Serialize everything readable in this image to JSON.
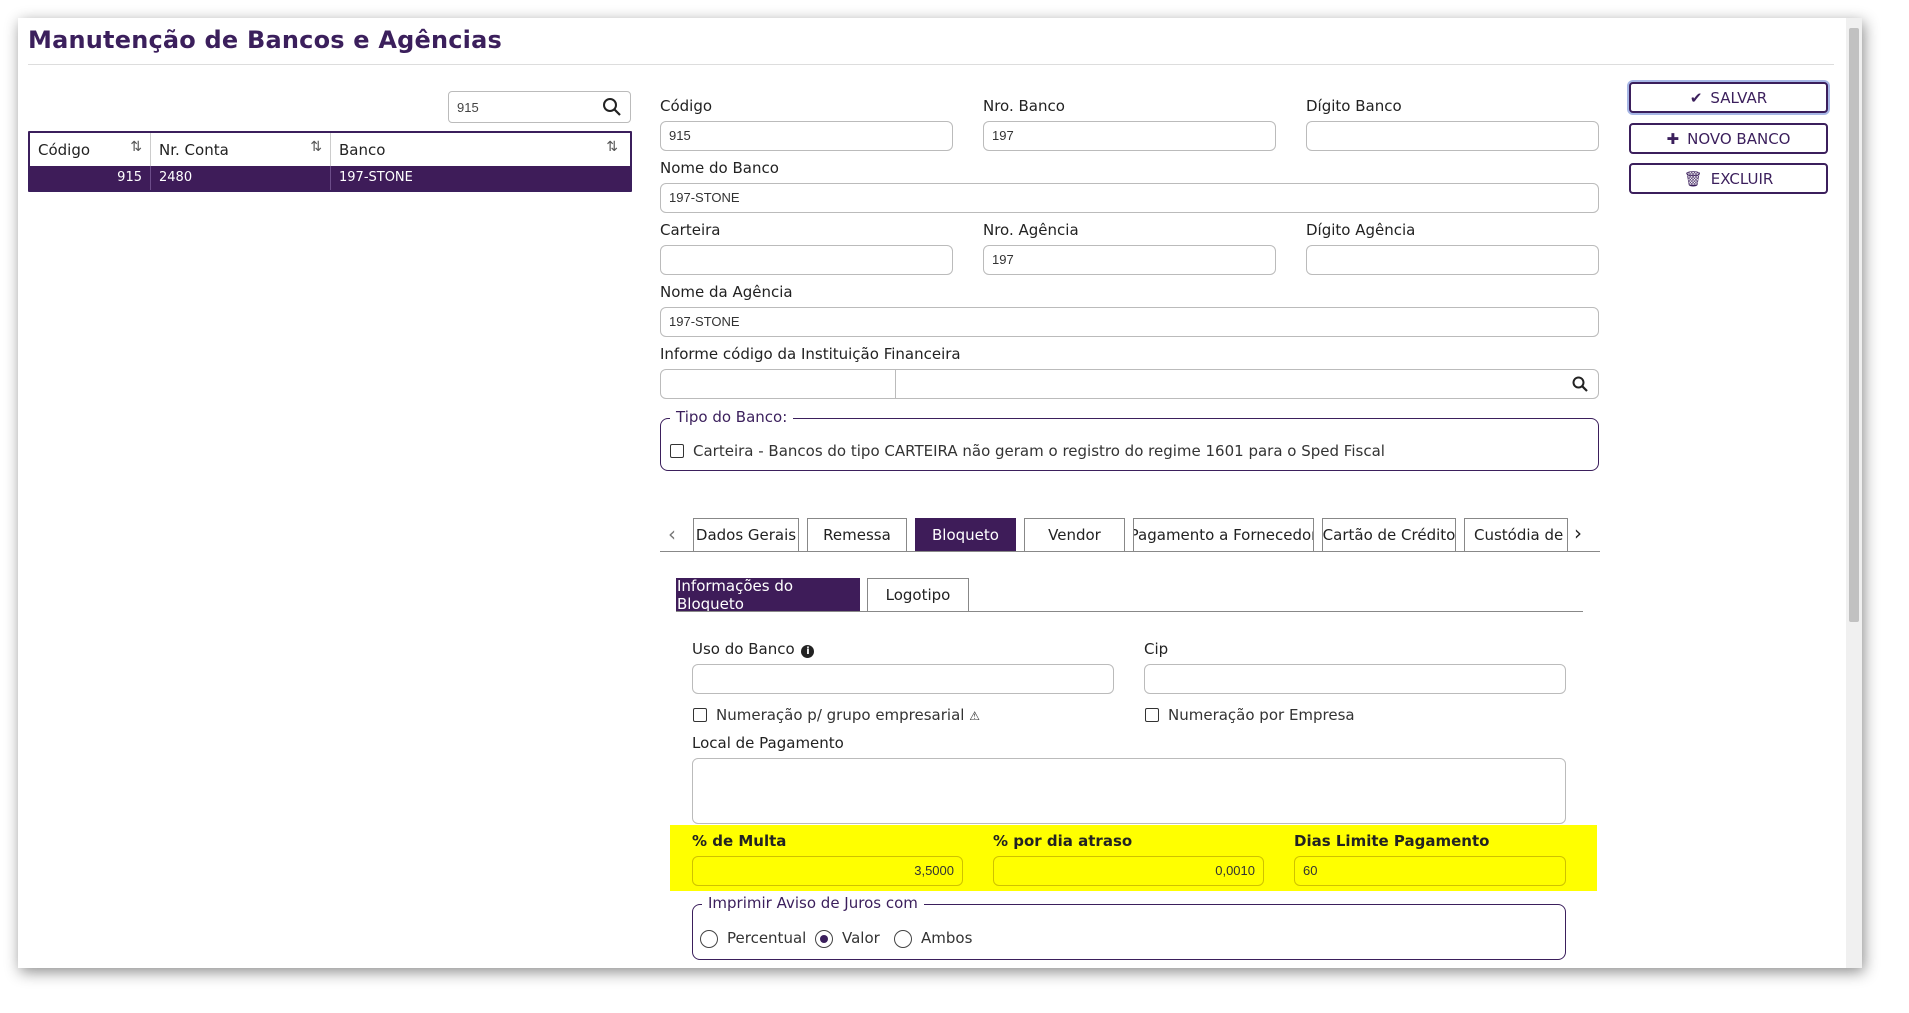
{
  "page": {
    "title": "Manutenção de Bancos e Agências"
  },
  "search": {
    "value": "915"
  },
  "grid": {
    "columns": [
      "Código",
      "Nr. Conta",
      "Banco"
    ],
    "rows": [
      {
        "codigo": "915",
        "nr_conta": "2480",
        "banco": "197-STONE"
      }
    ]
  },
  "form": {
    "codigo": {
      "label": "Código",
      "value": "915"
    },
    "nro_banco": {
      "label": "Nro. Banco",
      "value": "197"
    },
    "digito_banco": {
      "label": "Dígito Banco",
      "value": ""
    },
    "nome_banco": {
      "label": "Nome do Banco",
      "value": "197-STONE"
    },
    "carteira": {
      "label": "Carteira",
      "value": ""
    },
    "nro_agencia": {
      "label": "Nro. Agência",
      "value": "197"
    },
    "digito_agencia": {
      "label": "Dígito Agência",
      "value": ""
    },
    "nome_agencia": {
      "label": "Nome da Agência",
      "value": "197-STONE"
    },
    "instituicao": {
      "label": "Informe código da Instituição Financeira",
      "code": "",
      "name": ""
    },
    "tipo_banco": {
      "legend": "Tipo do Banco:",
      "carteira_text": "Carteira - Bancos do tipo CARTEIRA não geram o registro do regime 1601 para o Sped Fiscal",
      "carteira_checked": false
    }
  },
  "actions": {
    "save": "SALVAR",
    "new": "NOVO BANCO",
    "delete": "EXCLUIR"
  },
  "tabs": [
    "Dados Gerais",
    "Remessa",
    "Bloqueto",
    "Vendor",
    "Pagamento a Fornecedor",
    "Cartão de Crédito",
    "Custódia de C"
  ],
  "active_tab": "Bloqueto",
  "subtabs": [
    "Informações do Bloqueto",
    "Logotipo"
  ],
  "bloqueto": {
    "uso_banco": {
      "label": "Uso do Banco",
      "value": ""
    },
    "cip": {
      "label": "Cip",
      "value": ""
    },
    "num_grupo": {
      "label": "Numeração p/ grupo empresarial",
      "checked": false
    },
    "num_empresa": {
      "label": "Numeração por Empresa",
      "checked": false
    },
    "local_pagamento": {
      "label": "Local de Pagamento",
      "value": ""
    },
    "multa": {
      "label": "% de Multa",
      "value": "3,5000"
    },
    "dia_atraso": {
      "label": "% por dia atraso",
      "value": "0,0010"
    },
    "dias_limite": {
      "label": "Dias Limite Pagamento",
      "value": "60"
    },
    "aviso_juros": {
      "legend": "Imprimir Aviso de Juros com",
      "options": [
        "Percentual",
        "Valor",
        "Ambos"
      ],
      "selected": "Valor"
    }
  },
  "colors": {
    "primary": "#3b1f5c",
    "highlight": "#ffff00"
  }
}
